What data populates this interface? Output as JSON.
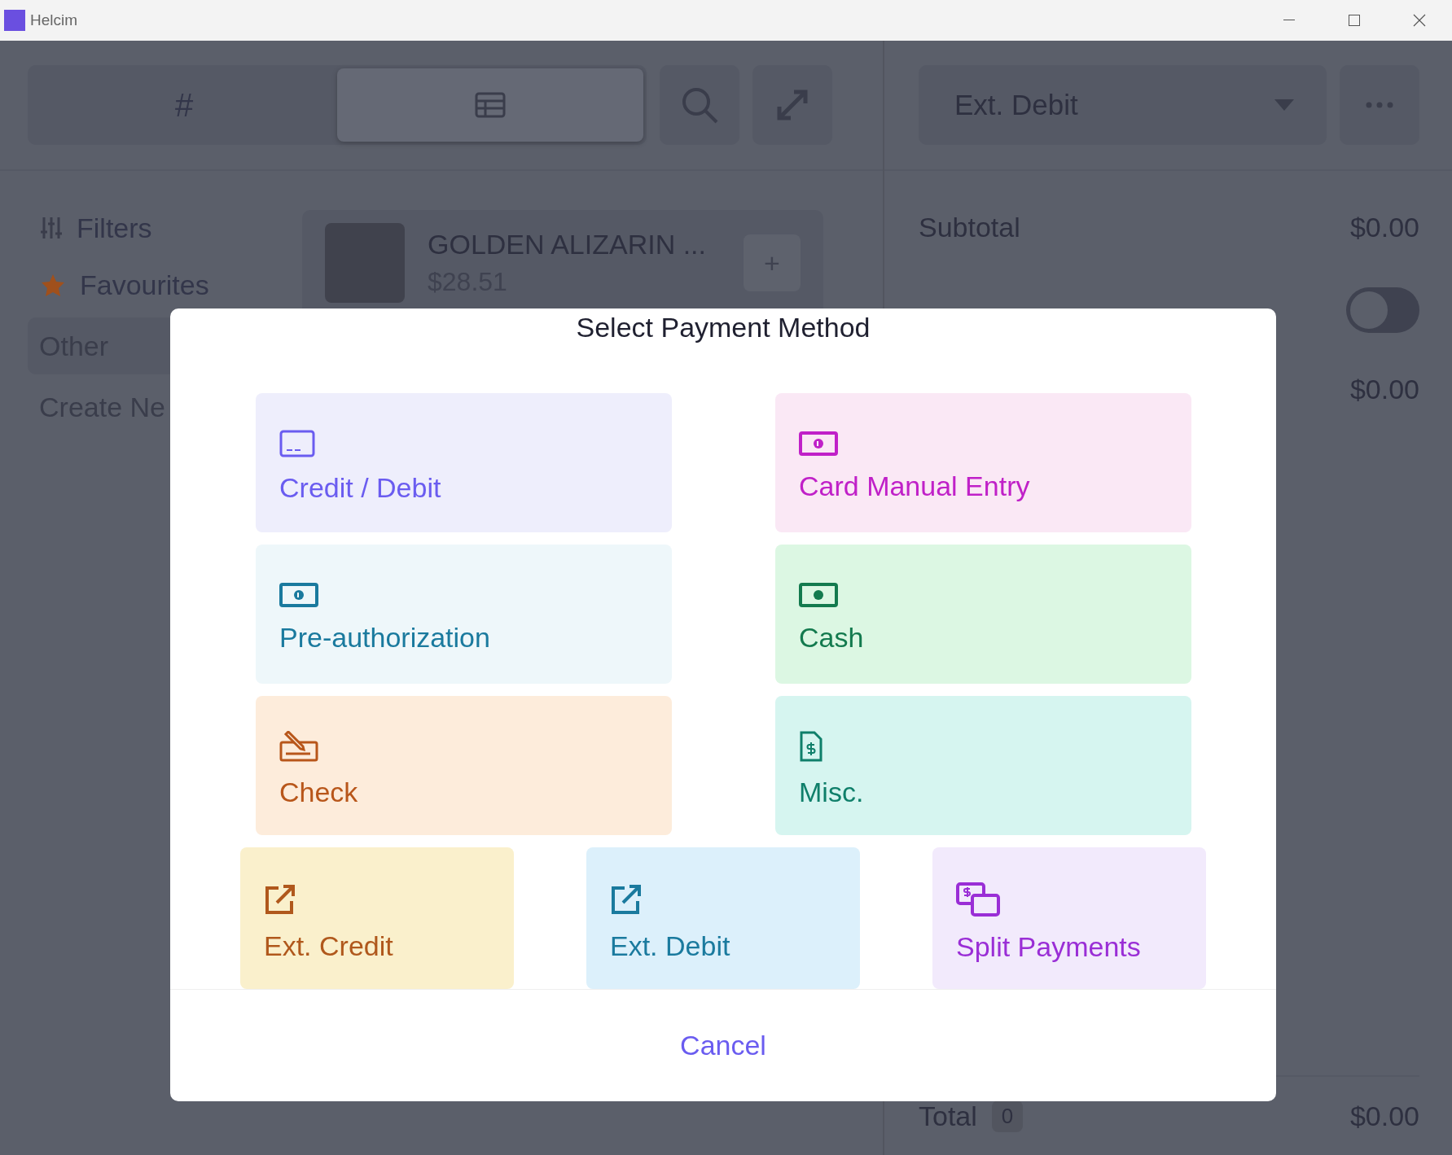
{
  "window": {
    "title": "Helcim"
  },
  "toolbar": {
    "tabs": [
      {
        "kind": "text",
        "label": "#",
        "selected": false
      },
      {
        "kind": "table",
        "selected": true
      }
    ],
    "payment_dropdown": {
      "value": "Ext. Debit"
    }
  },
  "sidebar": {
    "items": [
      {
        "label": "Filters",
        "kind": "filters",
        "selected": false
      },
      {
        "label": "Favourites",
        "kind": "favourites",
        "selected": false
      },
      {
        "label": "Other",
        "kind": "plain",
        "selected": true
      },
      {
        "label": "Create Ne",
        "kind": "plain",
        "selected": false
      }
    ]
  },
  "products": [
    {
      "name": "GOLDEN ALIZARIN ...",
      "price": "$28.51",
      "add_label": "+"
    }
  ],
  "summary": {
    "subtotal_label": "Subtotal",
    "subtotal": "$0.00",
    "toggle": {
      "on": false
    },
    "amount": "$0.00",
    "total_label": "Total",
    "total_count": "0",
    "total": "$0.00"
  },
  "dialog": {
    "title": "Select Payment Method",
    "methods": [
      {
        "label": "Credit / Debit",
        "kind": "credit_debit",
        "color": "#6a5cf0"
      },
      {
        "label": "Card Manual Entry",
        "kind": "manual",
        "color": "#c020c8"
      },
      {
        "label": "Pre-authorization",
        "kind": "preauth",
        "color": "#1a7a9e"
      },
      {
        "label": "Cash",
        "kind": "cash",
        "color": "#137a4e"
      },
      {
        "label": "Check",
        "kind": "check",
        "color": "#b8561a"
      },
      {
        "label": "Misc.",
        "kind": "misc",
        "color": "#0f7f6a"
      }
    ],
    "external_methods": [
      {
        "label": "Ext. Credit",
        "kind": "ext_credit",
        "color": "#b0581c"
      },
      {
        "label": "Ext. Debit",
        "kind": "ext_debit",
        "color": "#1a7a9e"
      },
      {
        "label": "Split Payments",
        "kind": "split",
        "color": "#9a2ed6"
      }
    ],
    "cancel": "Cancel"
  }
}
